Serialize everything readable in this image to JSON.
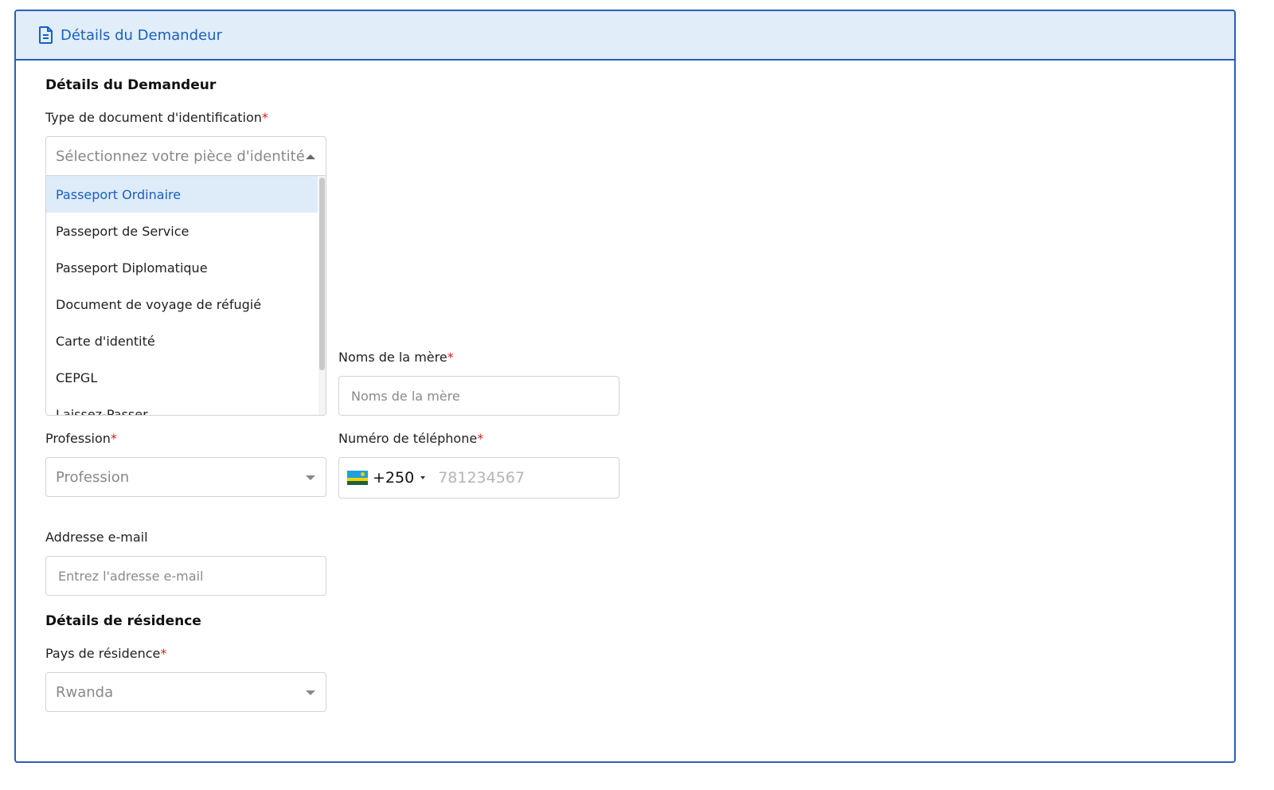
{
  "panel": {
    "header_title": "Détails du Demandeur",
    "header_icon": "document-icon"
  },
  "applicant": {
    "section_title": "Détails du Demandeur",
    "id_type": {
      "label": "Type de document d'identification",
      "required_mark": "*",
      "placeholder": "Sélectionnez votre pièce d'identité",
      "options": [
        "Passeport Ordinaire",
        "Passeport de Service",
        "Passeport Diplomatique",
        "Document de voyage de réfugié",
        "Carte d'identité",
        "CEPGL",
        "Laissez-Passer"
      ],
      "highlighted_option": "Passeport Ordinaire"
    },
    "mother_name": {
      "label": "Noms de la mère",
      "required_mark": "*",
      "placeholder": "Noms de la mère"
    },
    "profession": {
      "label": "Profession",
      "required_mark": "*",
      "placeholder": "Profession"
    },
    "phone": {
      "label": "Numéro de téléphone",
      "required_mark": "*",
      "dial_code": "+250",
      "country_flag": "rwanda-flag",
      "placeholder": "781234567"
    },
    "email": {
      "label": "Addresse e-mail",
      "placeholder": "Entrez l'adresse e-mail"
    }
  },
  "residence": {
    "section_title": "Détails de résidence",
    "country": {
      "label": "Pays de résidence",
      "required_mark": "*",
      "value": "Rwanda"
    }
  },
  "colors": {
    "accent": "#1a5fc0",
    "border": "#2a5fb8",
    "header_bg": "#e1edf9",
    "required": "#d32020"
  }
}
